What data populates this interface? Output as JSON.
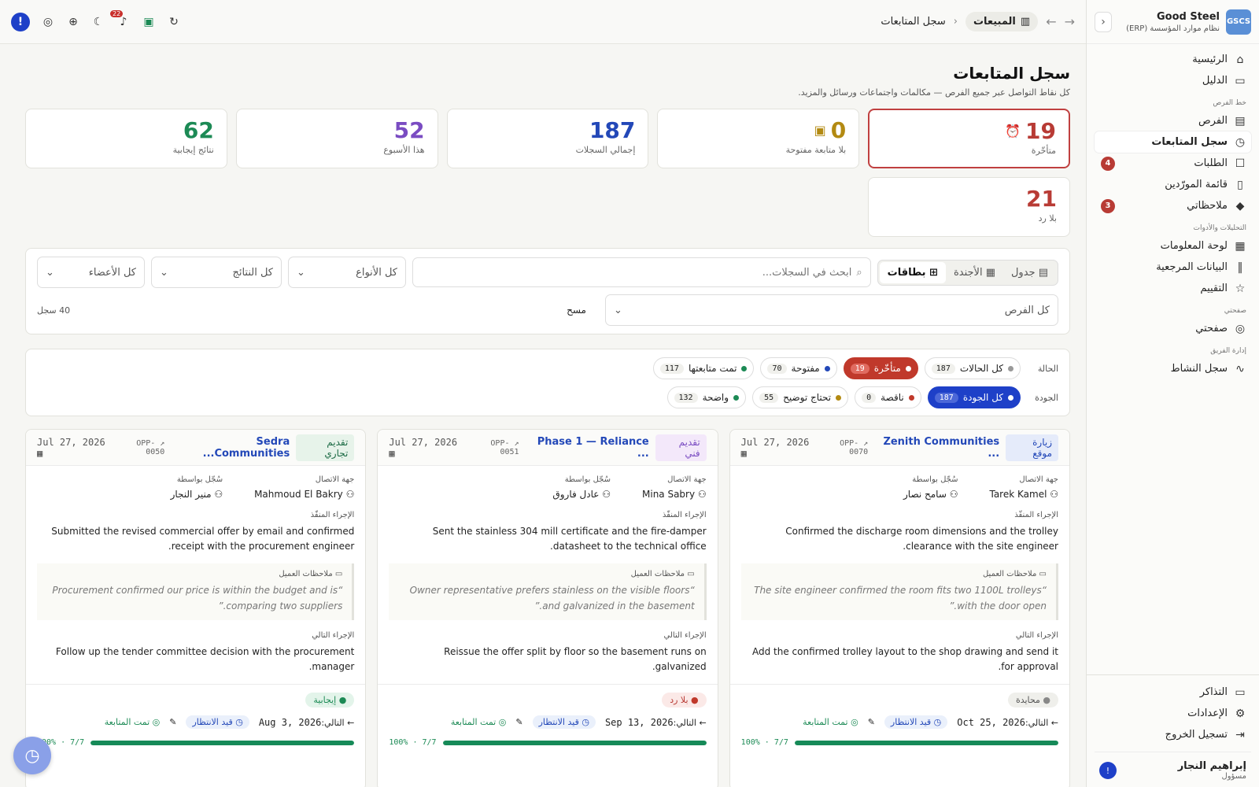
{
  "brand": {
    "logo": "GSCS",
    "name": "Good Steel",
    "subtitle": "نظام موارد المؤسسة (ERP)"
  },
  "nav": {
    "top": [
      {
        "label": "الرئيسية",
        "icon": "home-icon",
        "glyph": "⌂"
      },
      {
        "label": "الدليل",
        "icon": "book-icon",
        "glyph": "▭"
      }
    ],
    "sections": [
      {
        "title": "خط الفرص",
        "items": [
          {
            "label": "الفرص",
            "icon": "briefcase-icon",
            "glyph": "▤"
          },
          {
            "label": "سجل المتابعات",
            "icon": "calendar-clock-icon",
            "glyph": "◷",
            "active": true
          },
          {
            "label": "الطلبات",
            "icon": "chat-icon",
            "glyph": "☐",
            "badge": "4"
          },
          {
            "label": "قائمة المورّدين",
            "icon": "clipboard-icon",
            "glyph": "▯"
          },
          {
            "label": "ملاحظاتي",
            "icon": "graduation-icon",
            "glyph": "◆",
            "badge": "3"
          }
        ]
      },
      {
        "title": "التحليلات والأدوات",
        "items": [
          {
            "label": "لوحة المعلومات",
            "icon": "dashboard-icon",
            "glyph": "▦"
          },
          {
            "label": "البيانات المرجعية",
            "icon": "library-icon",
            "glyph": "‖"
          },
          {
            "label": "التقييم",
            "icon": "star-icon",
            "glyph": "☆"
          }
        ]
      },
      {
        "title": "صفحتي",
        "items": [
          {
            "label": "صفحتي",
            "icon": "check-circle-icon",
            "glyph": "◎"
          }
        ]
      },
      {
        "title": "إدارة الفريق",
        "items": [
          {
            "label": "سجل النشاط",
            "icon": "activity-icon",
            "glyph": "∿"
          }
        ]
      }
    ],
    "bottom": [
      {
        "label": "التذاكر",
        "icon": "ticket-icon",
        "glyph": "▭"
      },
      {
        "label": "الإعدادات",
        "icon": "gear-icon",
        "glyph": "⚙"
      },
      {
        "label": "تسجيل الخروج",
        "icon": "logout-icon",
        "glyph": "⇥"
      }
    ]
  },
  "user": {
    "name": "إبراهيم النجار",
    "role": "مسؤول",
    "initial": "!"
  },
  "header": {
    "section": "المبيعات",
    "current": "سجل المتابعات",
    "notif_count": "22"
  },
  "page": {
    "title": "سجل المتابعات",
    "subtitle": "كل نقاط التواصل عبر جميع الفرص — مكالمات واجتماعات ورسائل والمزيد."
  },
  "stats": [
    {
      "value": "19",
      "label": "متأخّرة",
      "color": "#b83b35",
      "icon": "⏰"
    },
    {
      "value": "0",
      "label": "بلا متابعة مفتوحة",
      "color": "#b38a12",
      "icon": "▣"
    },
    {
      "value": "187",
      "label": "إجمالي السجلات",
      "color": "#2348b8",
      "icon": ""
    },
    {
      "value": "52",
      "label": "هذا الأسبوع",
      "color": "#7a4cc2",
      "icon": ""
    },
    {
      "value": "62",
      "label": "نتائج إيجابية",
      "color": "#1c8a55",
      "icon": ""
    },
    {
      "value": "21",
      "label": "بلا رد",
      "color": "#b83b35",
      "icon": ""
    }
  ],
  "filters": {
    "view_table": "جدول",
    "view_agenda": "الأجندة",
    "view_cards": "بطاقات",
    "search_placeholder": "ابحث في السجلات...",
    "types": "كل الأنواع",
    "results": "كل النتائج",
    "members": "كل الأعضاء",
    "opps": "كل الفرص",
    "clear": "مسح",
    "count": "40 سجل"
  },
  "status_filter": {
    "label": "الحالة",
    "chips": [
      {
        "label": "كل الحالات",
        "count": "187",
        "dot": "#999"
      },
      {
        "label": "متأخّرة",
        "count": "19",
        "dot": "#fff",
        "style": "red"
      },
      {
        "label": "مفتوحة",
        "count": "70",
        "dot": "#2348b8"
      },
      {
        "label": "تمت متابعتها",
        "count": "117",
        "dot": "#1c8a55"
      }
    ]
  },
  "quality_filter": {
    "label": "الجودة",
    "chips": [
      {
        "label": "كل الجودة",
        "count": "187",
        "dot": "#fff",
        "style": "blue"
      },
      {
        "label": "ناقصة",
        "count": "0",
        "dot": "#c0392b"
      },
      {
        "label": "تحتاج توضيح",
        "count": "55",
        "dot": "#b38a12"
      },
      {
        "label": "واضحة",
        "count": "132",
        "dot": "#1c8a55"
      }
    ]
  },
  "labels": {
    "contact": "جهة الاتصال",
    "logged_by": "سُجّل بواسطة",
    "action": "الإجراء المنفّذ",
    "client_notes": "ملاحظات العميل",
    "next_action": "الإجراء التالي",
    "next": "التالي:",
    "pending": "قيد الانتظار",
    "done": "تمت المتابعة"
  },
  "cards": [
    {
      "type": "زيارة موقع",
      "type_bg": "#e5ebfa",
      "type_fg": "#2348b8",
      "opp": "Zenith Communities ...",
      "opp_id": "OPP-0070",
      "date": "Jul 27, 2026",
      "contact": "Tarek Kamel",
      "logged_by": "سامح نصار",
      "action": "Confirmed the discharge room dimensions and the trolley clearance with the site engineer.",
      "note": "“The site engineer confirmed the room fits two 1100L trolleys with the door open.”",
      "next": "Add the confirmed trolley layout to the shop drawing and send it for approval.",
      "result": "محايدة",
      "res_bg": "#efefeb",
      "res_fg": "#555",
      "res_dot": "#888",
      "next_date": "Oct 25, 2026",
      "progress": "100% · 7/7",
      "pct": 100
    },
    {
      "type": "تقديم فني",
      "type_bg": "#f3e8fa",
      "type_fg": "#7a4cc2",
      "opp": "Phase 1 — Reliance ...",
      "opp_id": "OPP-0051",
      "date": "Jul 27, 2026",
      "contact": "Mina Sabry",
      "logged_by": "عادل فاروق",
      "action": "Sent the stainless 304 mill certificate and the fire-damper datasheet to the technical office.",
      "note": "“Owner representative prefers stainless on the visible floors and galvanized in the basement.”",
      "next": "Reissue the offer split by floor so the basement runs on galvanized.",
      "result": "بلا رد",
      "res_bg": "#fbe9e7",
      "res_fg": "#b83b35",
      "res_dot": "#c0392b",
      "next_date": "Sep 13, 2026",
      "progress": "100% · 7/7",
      "pct": 100
    },
    {
      "type": "تقديم تجاري",
      "type_bg": "#e7f3ea",
      "type_fg": "#1c6b45",
      "opp": "Sedra Communities...",
      "opp_id": "OPP-0050",
      "date": "Jul 27, 2026",
      "contact": "Mahmoud El Bakry",
      "logged_by": "منير النجار",
      "action": "Submitted the revised commercial offer by email and confirmed receipt with the procurement engineer.",
      "note": "“Procurement confirmed our price is within the budget and is comparing two suppliers.”",
      "next": "Follow up the tender committee decision with the procurement manager.",
      "result": "إيجابية",
      "res_bg": "#e3f4ea",
      "res_fg": "#1c8a55",
      "res_dot": "#1c8a55",
      "next_date": "Aug 3, 2026",
      "progress": "100% · 7/7",
      "pct": 100
    }
  ]
}
